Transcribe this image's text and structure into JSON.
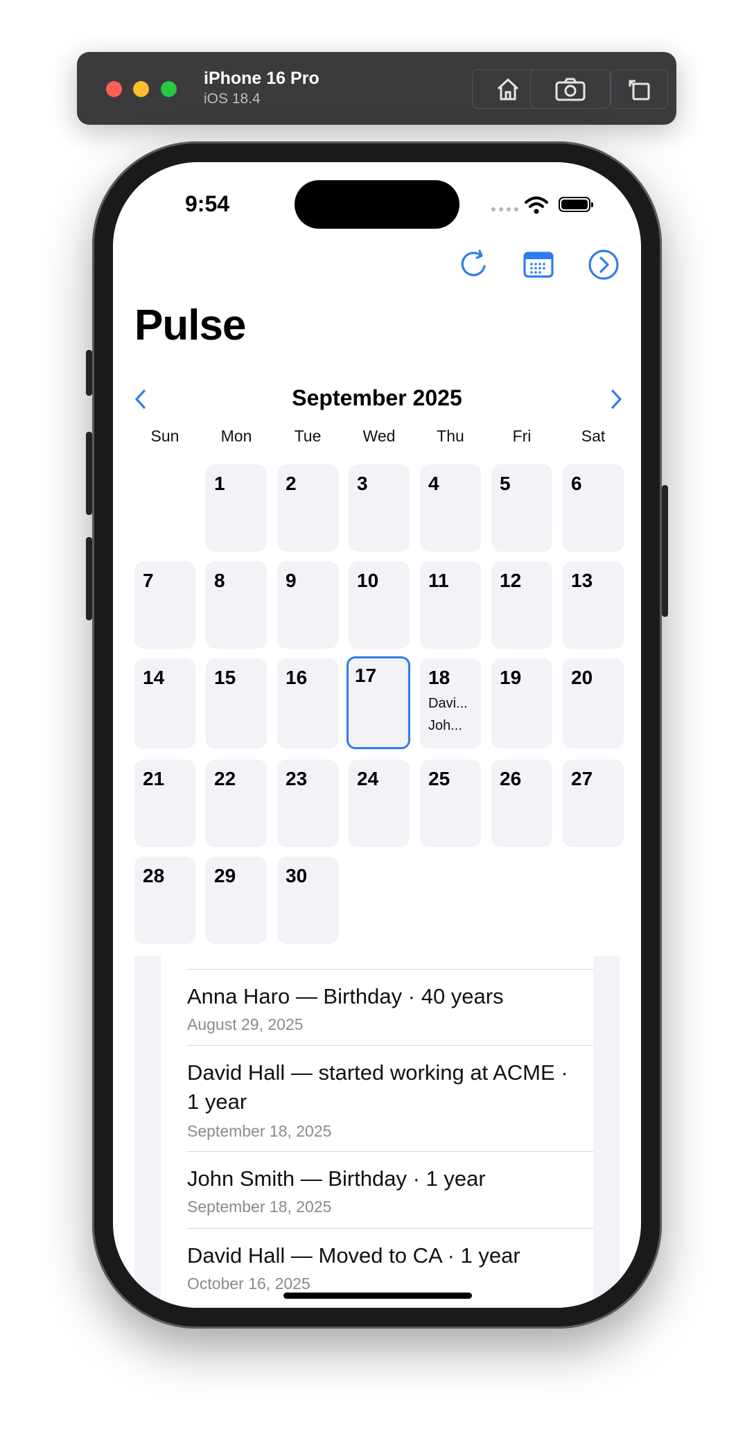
{
  "simulator": {
    "device_name": "iPhone 16 Pro",
    "os_version": "iOS 18.4",
    "buttons": [
      "home-icon",
      "screenshot-icon",
      "rotate-icon"
    ]
  },
  "status_bar": {
    "time": "9:54"
  },
  "toolbar": {
    "icons": [
      "refresh-icon",
      "calendar-icon",
      "chevron-right-circle-icon"
    ],
    "accent_color": "#2f7bf0"
  },
  "page_title": "Pulse",
  "calendar": {
    "month_title": "September 2025",
    "weekdays": [
      "Sun",
      "Mon",
      "Tue",
      "Wed",
      "Thu",
      "Fri",
      "Sat"
    ],
    "days": [
      "1",
      "2",
      "3",
      "4",
      "5",
      "6",
      "7",
      "8",
      "9",
      "10",
      "11",
      "12",
      "13",
      "14",
      "15",
      "16",
      "17",
      "18",
      "19",
      "20",
      "21",
      "22",
      "23",
      "24",
      "25",
      "26",
      "27",
      "28",
      "29",
      "30"
    ],
    "selected_day": "17",
    "day_events": {
      "18": [
        "Davi...",
        "Joh..."
      ]
    }
  },
  "events_list": [
    {
      "title": "Anna Haro — Birthday · 40 years",
      "date": "August 29, 2025"
    },
    {
      "title": "David Hall — started working at ACME · 1 year",
      "date": "September 18, 2025"
    },
    {
      "title": "John Smith — Birthday · 1 year",
      "date": "September 18, 2025"
    },
    {
      "title": "David Hall — Moved to CA · 1 year",
      "date": "October 16, 2025"
    }
  ]
}
